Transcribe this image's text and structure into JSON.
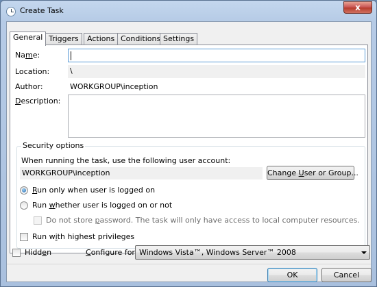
{
  "window": {
    "title": "Create Task",
    "close_label": "x"
  },
  "tabs": [
    {
      "label": "General",
      "active": true
    },
    {
      "label": "Triggers"
    },
    {
      "label": "Actions"
    },
    {
      "label": "Conditions"
    },
    {
      "label": "Settings"
    }
  ],
  "general": {
    "name_label_pre": "Na",
    "name_label_u": "m",
    "name_label_post": "e:",
    "name_value": "",
    "location_label": "Location:",
    "location_value": "\\",
    "author_label": "Author:",
    "author_value": "WORKGROUP\\inception",
    "description_label_u": "D",
    "description_label_post": "escription:",
    "description_value": ""
  },
  "security": {
    "title": "Security options",
    "account_prompt": "When running the task, use the following user account:",
    "account_value": "WORKGROUP\\inception",
    "change_btn_pre": "Change ",
    "change_btn_u": "U",
    "change_btn_post": "ser or Group...",
    "radio_logged_on_u": "R",
    "radio_logged_on_post": "un only when user is logged on",
    "radio_whether_pre": "Run ",
    "radio_whether_u": "w",
    "radio_whether_post": "hether user is logged on or not",
    "no_store_pre": "Do not store ",
    "no_store_u": "p",
    "no_store_post": "assword.  The task will only have access to local computer resources.",
    "highest_pre": "Run w",
    "highest_u": "i",
    "highest_post": "th highest privileges"
  },
  "footer": {
    "hidden_pre": "Hidd",
    "hidden_u": "e",
    "hidden_post": "n",
    "configure_u": "C",
    "configure_post": "onfigure for:",
    "configure_value": "Windows Vista™, Windows Server™ 2008",
    "ok_label": "OK",
    "cancel_label": "Cancel"
  }
}
